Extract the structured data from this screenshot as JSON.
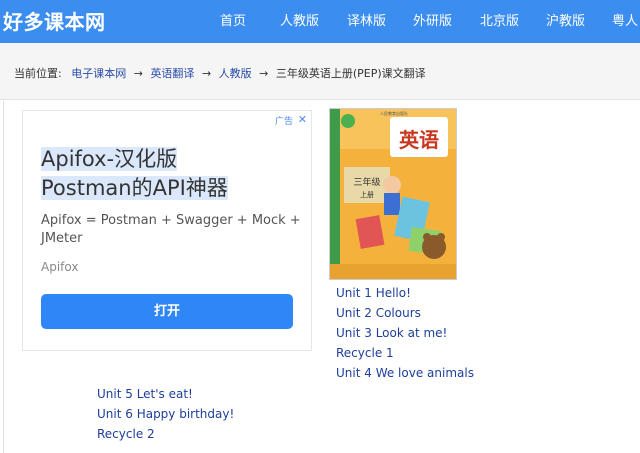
{
  "site": {
    "logo": "好多课本网"
  },
  "nav": [
    "首页",
    "人教版",
    "译林版",
    "外研版",
    "北京版",
    "沪教版",
    "粤人"
  ],
  "breadcrumb": {
    "prefix": "当前位置:",
    "items": [
      "电子课本网",
      "英语翻译",
      "人教版"
    ],
    "arrow": "→",
    "current": "三年级英语上册(PEP)课文翻译"
  },
  "ad": {
    "label": "广告",
    "title_line1": "Apifox-汉化版",
    "title_line2": "Postman的API神器",
    "description": "Apifox = Postman + Swagger + Mock + JMeter",
    "brand": "Apifox",
    "button": "打开"
  },
  "book": {
    "title": "英语",
    "grade": "三年级",
    "volume": "上册",
    "publisher": "人民教育出版社"
  },
  "units_right": [
    "Unit 1 Hello!",
    "Unit 2 Colours",
    "Unit 3 Look at me!",
    "Recycle 1",
    "Unit 4 We love animals"
  ],
  "units_left": [
    "Unit 5 Let's eat!",
    "Unit 6 Happy birthday!",
    "Recycle 2"
  ],
  "colors": {
    "header": "#3b8ef0",
    "link": "#1e3f9a",
    "button": "#2f86f6"
  }
}
